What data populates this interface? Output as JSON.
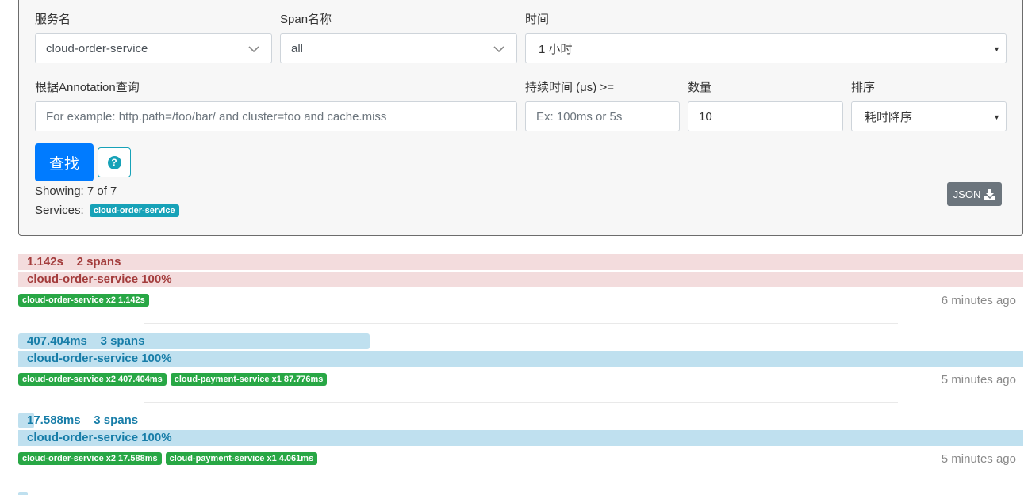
{
  "form": {
    "service_label": "服务名",
    "service_value": "cloud-order-service",
    "span_label": "Span名称",
    "span_value": "all",
    "time_label": "时间",
    "time_value": "1 小时",
    "annotation_label": "根据Annotation查询",
    "annotation_placeholder": "For example: http.path=/foo/bar/ and cluster=foo and cache.miss",
    "duration_label": "持续时间 (μs) >=",
    "duration_placeholder": "Ex: 100ms or 5s",
    "limit_label": "数量",
    "limit_value": "10",
    "sort_label": "排序",
    "sort_value": "耗时降序",
    "find_button": "查找",
    "help_icon": "question-circle-icon",
    "help_glyph": "?"
  },
  "summary": {
    "showing": "Showing: 7 of 7",
    "services_label": "Services:",
    "services_badge": "cloud-order-service",
    "json_button": "JSON",
    "json_icon": "download-icon"
  },
  "colors": {
    "primary": "#007bff",
    "info": "#17a2b8",
    "success": "#28a745",
    "secondary": "#6c757d",
    "error_bar": "#f3dcdd",
    "error_text": "#a33c3c",
    "normal_bar": "#bfe0ef",
    "normal_text": "#177da8"
  },
  "traces": [
    {
      "duration": "1.142s",
      "spans": "2 spans",
      "duration_fraction": 1.0,
      "service_summary": "cloud-order-service 100%",
      "tags": [
        "cloud-order-service x2 1.142s"
      ],
      "ago": "6 minutes ago",
      "status": "error"
    },
    {
      "duration": "407.404ms",
      "spans": "3 spans",
      "duration_fraction": 0.35,
      "service_summary": "cloud-order-service 100%",
      "tags": [
        "cloud-order-service x2 407.404ms",
        "cloud-payment-service x1 87.776ms"
      ],
      "ago": "5 minutes ago",
      "status": "normal"
    },
    {
      "duration": "17.588ms",
      "spans": "3 spans",
      "duration_fraction": 0.0154,
      "service_summary": "cloud-order-service 100%",
      "tags": [
        "cloud-order-service x2 17.588ms",
        "cloud-payment-service x1 4.061ms"
      ],
      "ago": "5 minutes ago",
      "status": "normal"
    }
  ]
}
